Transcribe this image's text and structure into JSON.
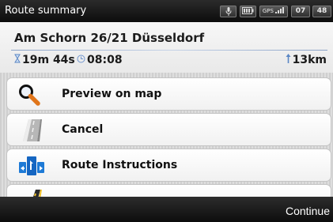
{
  "status_bar": {
    "title": "Route summary",
    "gps_label": "GPS",
    "clock_hours": "07",
    "clock_minutes": "48"
  },
  "route": {
    "address": "Am Schorn 26/21  Düsseldorf",
    "duration": "19m 44s",
    "arrival_time": "08:08",
    "distance": "13km"
  },
  "menu": {
    "items": [
      {
        "label": "Preview on map",
        "icon": "magnifier-icon"
      },
      {
        "label": "Cancel",
        "icon": "cancel-road-icon"
      },
      {
        "label": "Route Instructions",
        "icon": "route-instructions-icon"
      },
      {
        "label": "",
        "icon": "road-icon"
      }
    ]
  },
  "footer": {
    "continue_label": "Continue"
  }
}
